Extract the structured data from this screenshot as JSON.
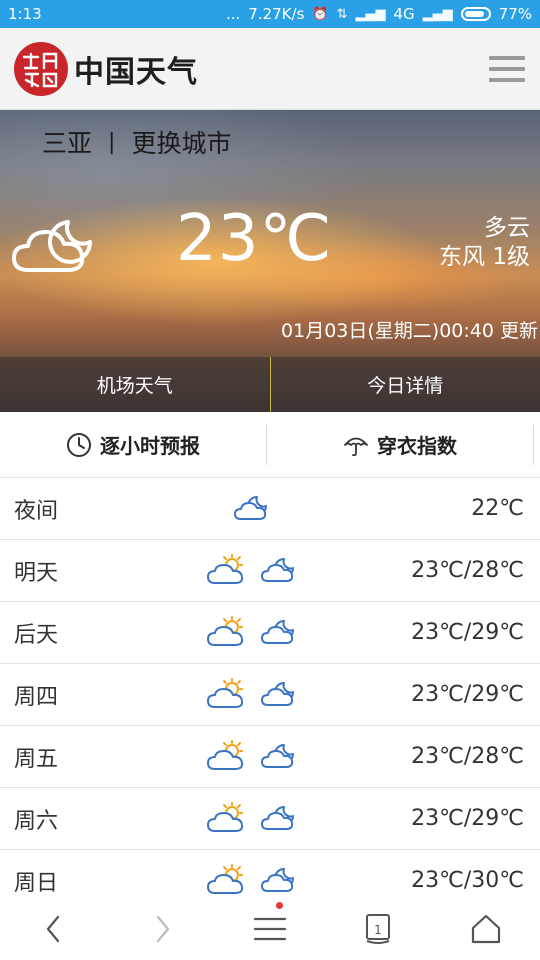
{
  "status_bar": {
    "time": "1:13",
    "dots": "...",
    "speed": "7.27K/s",
    "network": "4G",
    "battery": "77%"
  },
  "header": {
    "brand": "中国天气",
    "logo_icon": "china-weather-seal-logo",
    "menu_icon": "hamburger-menu-icon"
  },
  "hero": {
    "city": "三亚",
    "divider": "|",
    "change_city": "更换城市",
    "temperature": "23℃",
    "condition": "多云",
    "wind": "东风 1级",
    "updated": "01月03日(星期二)00:40 更新",
    "tabs": [
      "机场天气",
      "今日详情"
    ],
    "weather_icon": "cloudy-night-icon"
  },
  "forecast_tabs": {
    "hourly": "逐小时预报",
    "clothing": "穿衣指数",
    "hourly_icon": "clock-icon",
    "clothing_icon": "umbrella-icon"
  },
  "forecast": [
    {
      "day": "夜间",
      "icons": [
        "cloudy-night"
      ],
      "temp": "22℃"
    },
    {
      "day": "明天",
      "icons": [
        "partly-cloudy-day",
        "cloudy-night"
      ],
      "temp": "23℃/28℃"
    },
    {
      "day": "后天",
      "icons": [
        "partly-cloudy-day",
        "cloudy-night"
      ],
      "temp": "23℃/29℃"
    },
    {
      "day": "周四",
      "icons": [
        "partly-cloudy-day",
        "cloudy-night"
      ],
      "temp": "23℃/29℃"
    },
    {
      "day": "周五",
      "icons": [
        "partly-cloudy-day",
        "cloudy-night"
      ],
      "temp": "23℃/28℃"
    },
    {
      "day": "周六",
      "icons": [
        "partly-cloudy-day",
        "cloudy-night"
      ],
      "temp": "23℃/29℃"
    },
    {
      "day": "周日",
      "icons": [
        "partly-cloudy-day",
        "cloudy-night"
      ],
      "temp": "23℃/30℃"
    }
  ],
  "nav": {
    "tab_count": "1",
    "items": [
      "back-icon",
      "forward-icon",
      "menu-icon",
      "tabs-icon",
      "home-icon"
    ]
  },
  "colors": {
    "status_bar": "#2aa0e6",
    "icon_blue": "#3a74c2",
    "icon_sun": "#f2a31c",
    "logo_red": "#c8262b"
  }
}
